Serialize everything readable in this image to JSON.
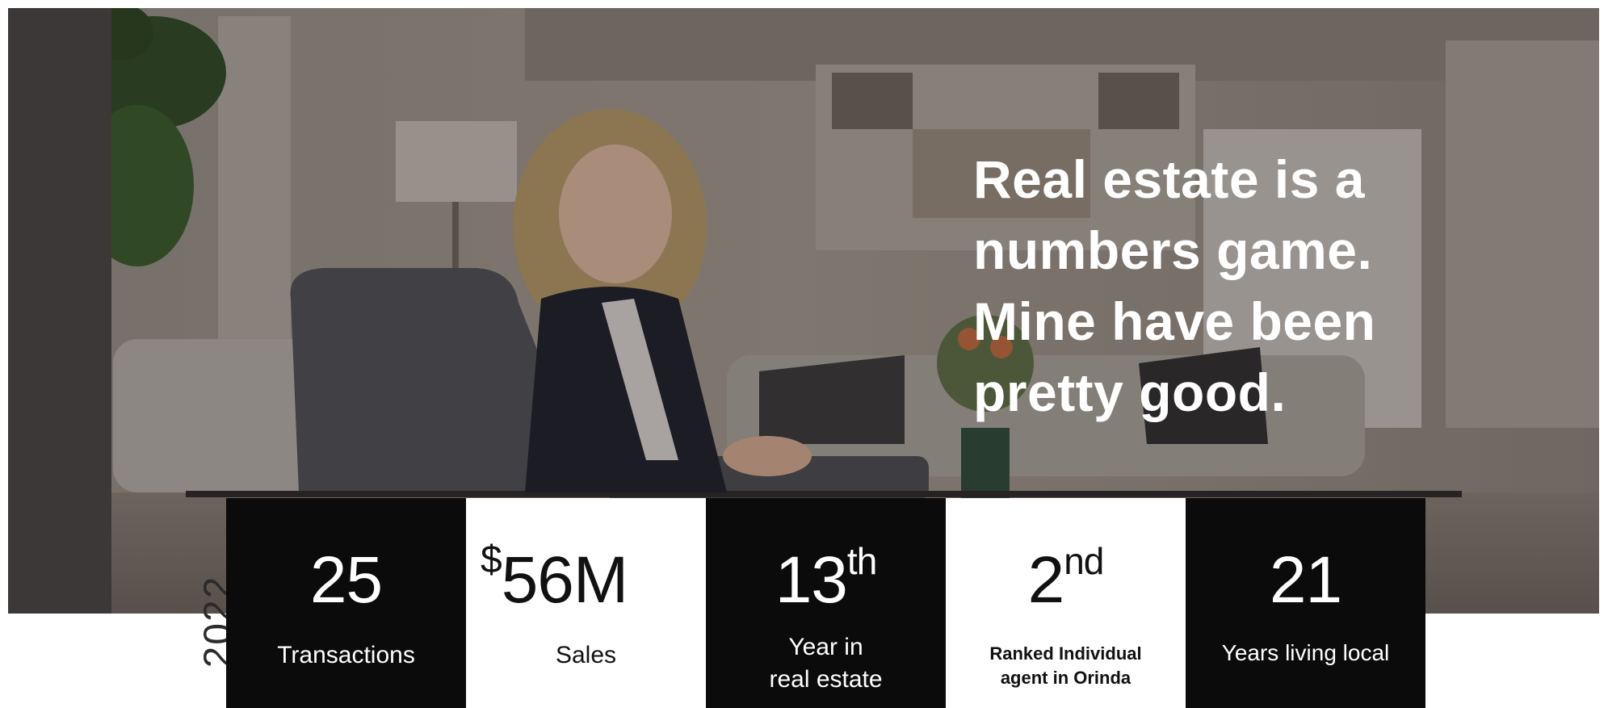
{
  "headline": [
    "Real estate is a",
    "numbers game.",
    "Mine have been",
    "pretty good."
  ],
  "year": "2022",
  "stats": [
    {
      "prefix": "",
      "value": "25",
      "suffix": "",
      "label_lines": [
        "Transactions"
      ]
    },
    {
      "prefix": "$",
      "value": "56M",
      "suffix": "",
      "label_lines": [
        "Sales"
      ]
    },
    {
      "prefix": "",
      "value": "13",
      "suffix": "th",
      "label_lines": [
        "Year in",
        "real estate"
      ]
    },
    {
      "prefix": "",
      "value": "2",
      "suffix": "nd",
      "label_lines": [
        "Ranked Individual",
        "agent in Orinda"
      ]
    },
    {
      "prefix": "",
      "value": "21",
      "suffix": "",
      "label_lines": [
        "Years living local"
      ]
    }
  ],
  "colors": {
    "dark_box": "#0b0b0b",
    "light_box": "#ffffff",
    "strip": "#3d3838",
    "headline": "#ffffff"
  },
  "photo": "agent-seated-in-armchair-living-room"
}
